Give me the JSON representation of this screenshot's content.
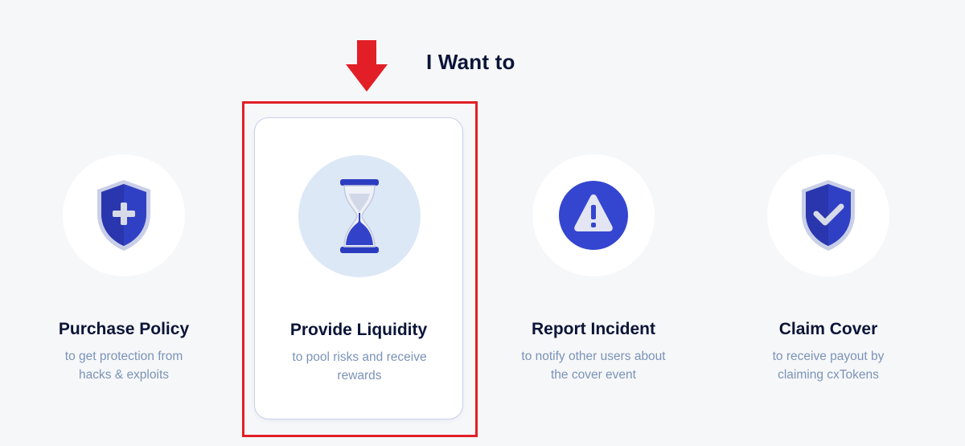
{
  "heading": "I Want to",
  "cards": [
    {
      "title": "Purchase Policy",
      "desc": "to get protection from hacks & exploits",
      "icon": "shield-plus-icon"
    },
    {
      "title": "Provide Liquidity",
      "desc": "to pool risks and receive rewards",
      "icon": "hourglass-icon"
    },
    {
      "title": "Report Incident",
      "desc": "to notify other users about the cover event",
      "icon": "warning-icon"
    },
    {
      "title": "Claim Cover",
      "desc": "to receive payout by claiming cxTokens",
      "icon": "shield-check-icon"
    }
  ],
  "selected_index": 1,
  "colors": {
    "accent": "#2f3fbf",
    "highlight": "#e21f26",
    "title": "#0b1437",
    "desc": "#7a93b8"
  }
}
